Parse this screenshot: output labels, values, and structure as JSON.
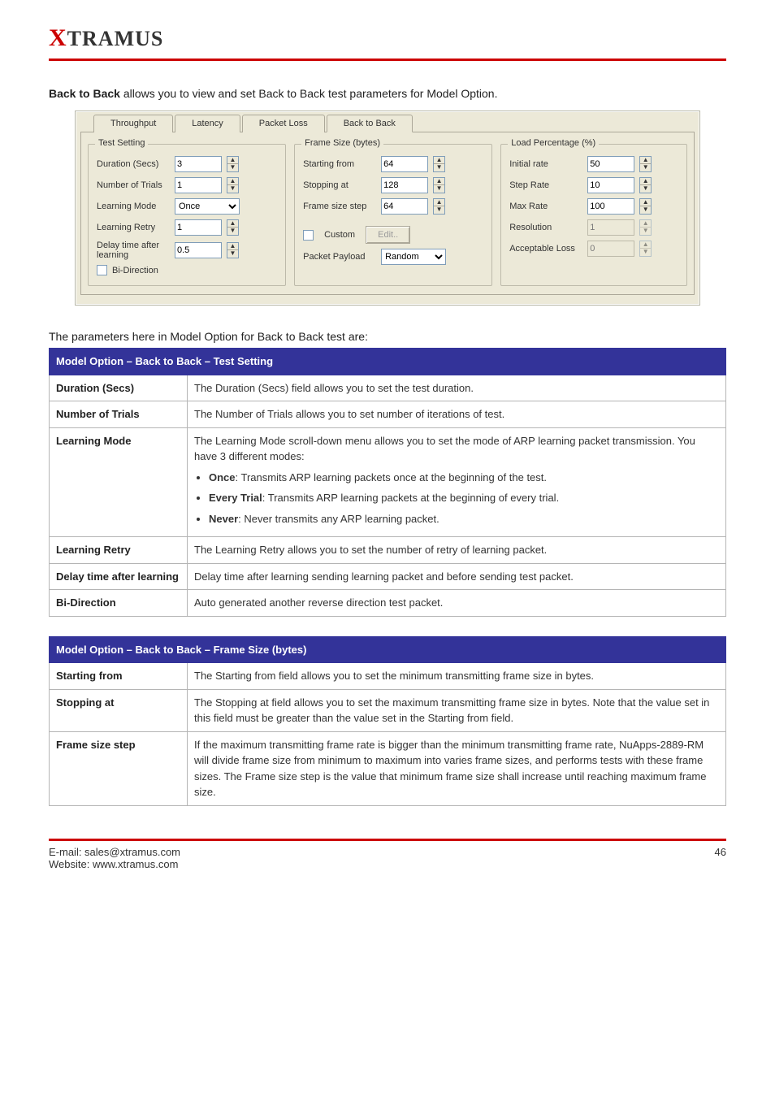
{
  "brand": {
    "name_x": "X",
    "name_rest": "TRAMUS"
  },
  "intro": {
    "bold": "Back to Back",
    "rest": " allows you to view and set Back to Back test parameters for Model Option."
  },
  "dialog": {
    "tabs": [
      "Throughput",
      "Latency",
      "Packet Loss",
      "Back to Back"
    ],
    "selected_tab": "Back to Back",
    "groups": {
      "test": {
        "title": "Test Setting",
        "duration_label": "Duration (Secs)",
        "duration_value": "3",
        "trials_label": "Number of Trials",
        "trials_value": "1",
        "mode_label": "Learning Mode",
        "mode_value": "Once",
        "mode_options": [
          "Once",
          "Every Trial",
          "Never"
        ],
        "retry_label": "Learning Retry",
        "retry_value": "1",
        "delay_label": "Delay time after learning",
        "delay_value": "0.5",
        "bidir_label": "Bi-Direction"
      },
      "frame": {
        "title": "Frame Size  (bytes)",
        "from_label": "Starting from",
        "from_value": "64",
        "to_label": "Stopping at",
        "to_value": "128",
        "step_label": "Frame size step",
        "step_value": "64",
        "custom_label": "Custom",
        "edit_btn": "Edit..",
        "payload_label": "Packet Payload",
        "payload_value": "Random",
        "payload_options": [
          "Random"
        ]
      },
      "load": {
        "title": "Load Percentage (%)",
        "init_label": "Initial rate",
        "init_value": "50",
        "step_label": "Step Rate",
        "step_value": "10",
        "max_label": "Max Rate",
        "max_value": "100",
        "res_label": "Resolution",
        "res_value": "1",
        "loss_label": "Acceptable Loss",
        "loss_value": "0"
      }
    }
  },
  "tables_intro": "The parameters here in Model Option for Back to Back test are:",
  "table_test": {
    "header": "Model Option – Back to Back – Test Setting",
    "rows": [
      {
        "k": "Duration (Secs)",
        "v": "The Duration (Secs) field allows you to set the test duration."
      },
      {
        "k": "Number of Trials",
        "v": "The Number of Trials allows you to set number of iterations of test."
      },
      {
        "k": "Learning Mode",
        "v_intro": "The Learning Mode scroll-down menu allows you to set the mode of ARP learning packet transmission. You have 3 different modes:",
        "bullets": [
          {
            "b": "Once",
            "t": ": Transmits ARP learning packets once at the beginning of the test."
          },
          {
            "b": "Every Trial",
            "t": ": Transmits ARP learning packets at the beginning of every trial."
          },
          {
            "b": "Never",
            "t": ": Never transmits any ARP learning packet."
          }
        ]
      },
      {
        "k": "Learning Retry",
        "v": "The Learning Retry allows you to set the number of retry of learning packet."
      },
      {
        "k": "Delay time after learning",
        "v": "Delay time after learning sending learning packet and before sending test packet."
      },
      {
        "k": "Bi-Direction",
        "v": "Auto generated another reverse direction test packet."
      }
    ]
  },
  "table_frame": {
    "header": "Model Option – Back to Back – Frame Size (bytes)",
    "rows": [
      {
        "k": "Starting from",
        "v": "The Starting from field allows you to set the minimum transmitting frame size in bytes."
      },
      {
        "k": "Stopping at",
        "v": "The Stopping at field allows you to set the maximum transmitting frame size in bytes. Note that the value set in this field must be greater than the value set in the Starting from field."
      },
      {
        "k": "Frame size step",
        "v": "If the maximum transmitting frame rate is bigger than the minimum transmitting frame rate, NuApps-2889-RM will divide frame size from minimum to maximum into varies frame sizes, and performs tests with these frame sizes. The Frame size step is the value that minimum frame size shall increase until reaching maximum frame size."
      }
    ]
  },
  "footer": {
    "left": "E-mail: sales@xtramus.com",
    "right": "46",
    "site": "Website: www.xtramus.com"
  }
}
